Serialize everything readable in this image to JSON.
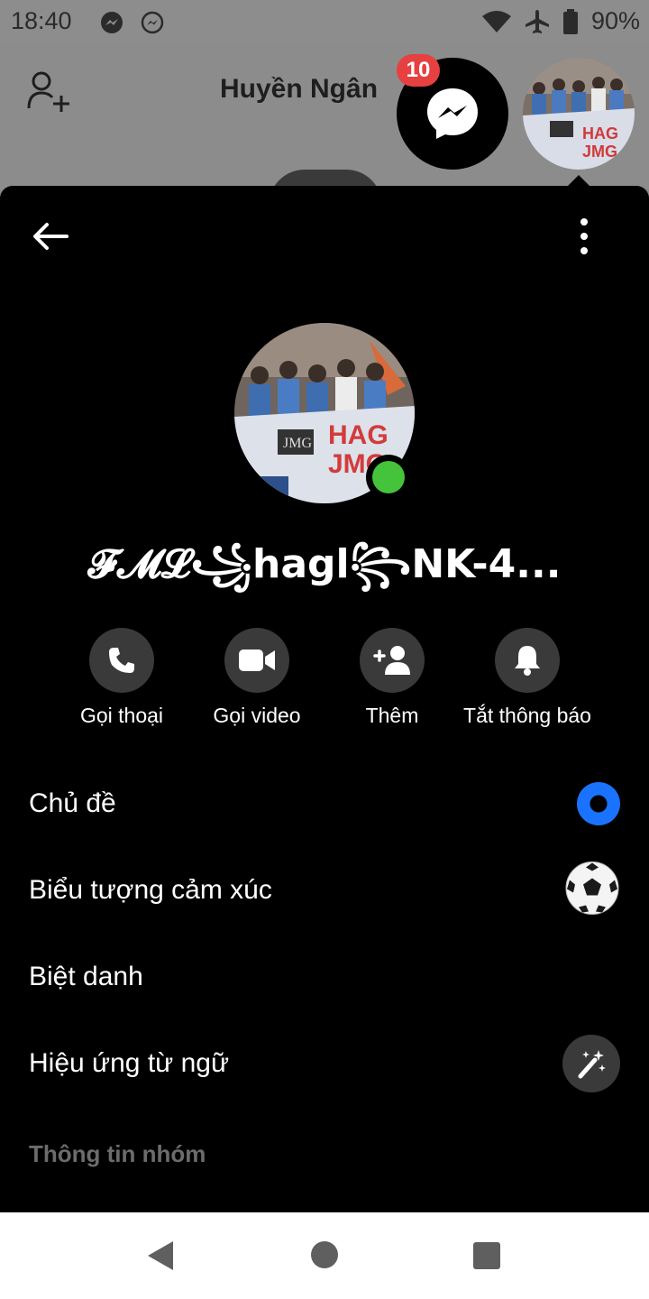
{
  "status_bar": {
    "time": "18:40",
    "battery": "90%",
    "icons": [
      "messenger-icon",
      "messenger-icon",
      "wifi-icon",
      "airplane-icon",
      "battery-icon"
    ]
  },
  "background": {
    "contact_name": "Huyền Ngân",
    "unread_badge": "10"
  },
  "group": {
    "name": "𝓕𝓜𝓛꧁hagl꧂NK-4..."
  },
  "actions": [
    {
      "label": "Gọi thoại",
      "icon": "phone-icon"
    },
    {
      "label": "Gọi video",
      "icon": "video-camera-icon"
    },
    {
      "label": "Thêm",
      "icon": "add-person-icon"
    },
    {
      "label": "Tắt thông báo",
      "icon": "bell-icon"
    }
  ],
  "settings": {
    "theme": "Chủ đề",
    "emoji": "Biểu tượng cảm xúc",
    "emoji_value": "⚽",
    "nicknames": "Biệt danh",
    "word_effects": "Hiệu ứng từ ngữ",
    "section_group_info": "Thông tin nhóm"
  },
  "colors": {
    "accent": "#1a73ff",
    "online": "#45c33b",
    "badge": "#e64040",
    "panel_bg": "#000000"
  }
}
